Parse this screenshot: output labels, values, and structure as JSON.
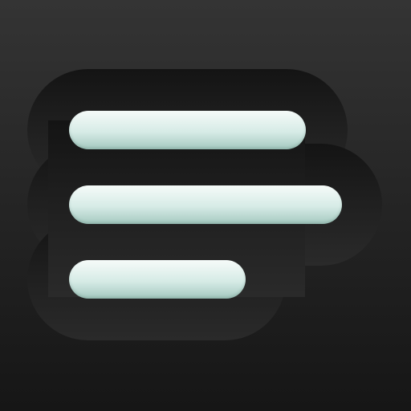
{
  "icon": {
    "name": "menu-icon",
    "bar_count": 3
  },
  "colors": {
    "background_top": "#343434",
    "background_bottom": "#161616",
    "plate_dark": "#161616",
    "plate_light": "#272727",
    "bar_top": "#f6fbf9",
    "bar_bottom": "#a5c9c0"
  }
}
